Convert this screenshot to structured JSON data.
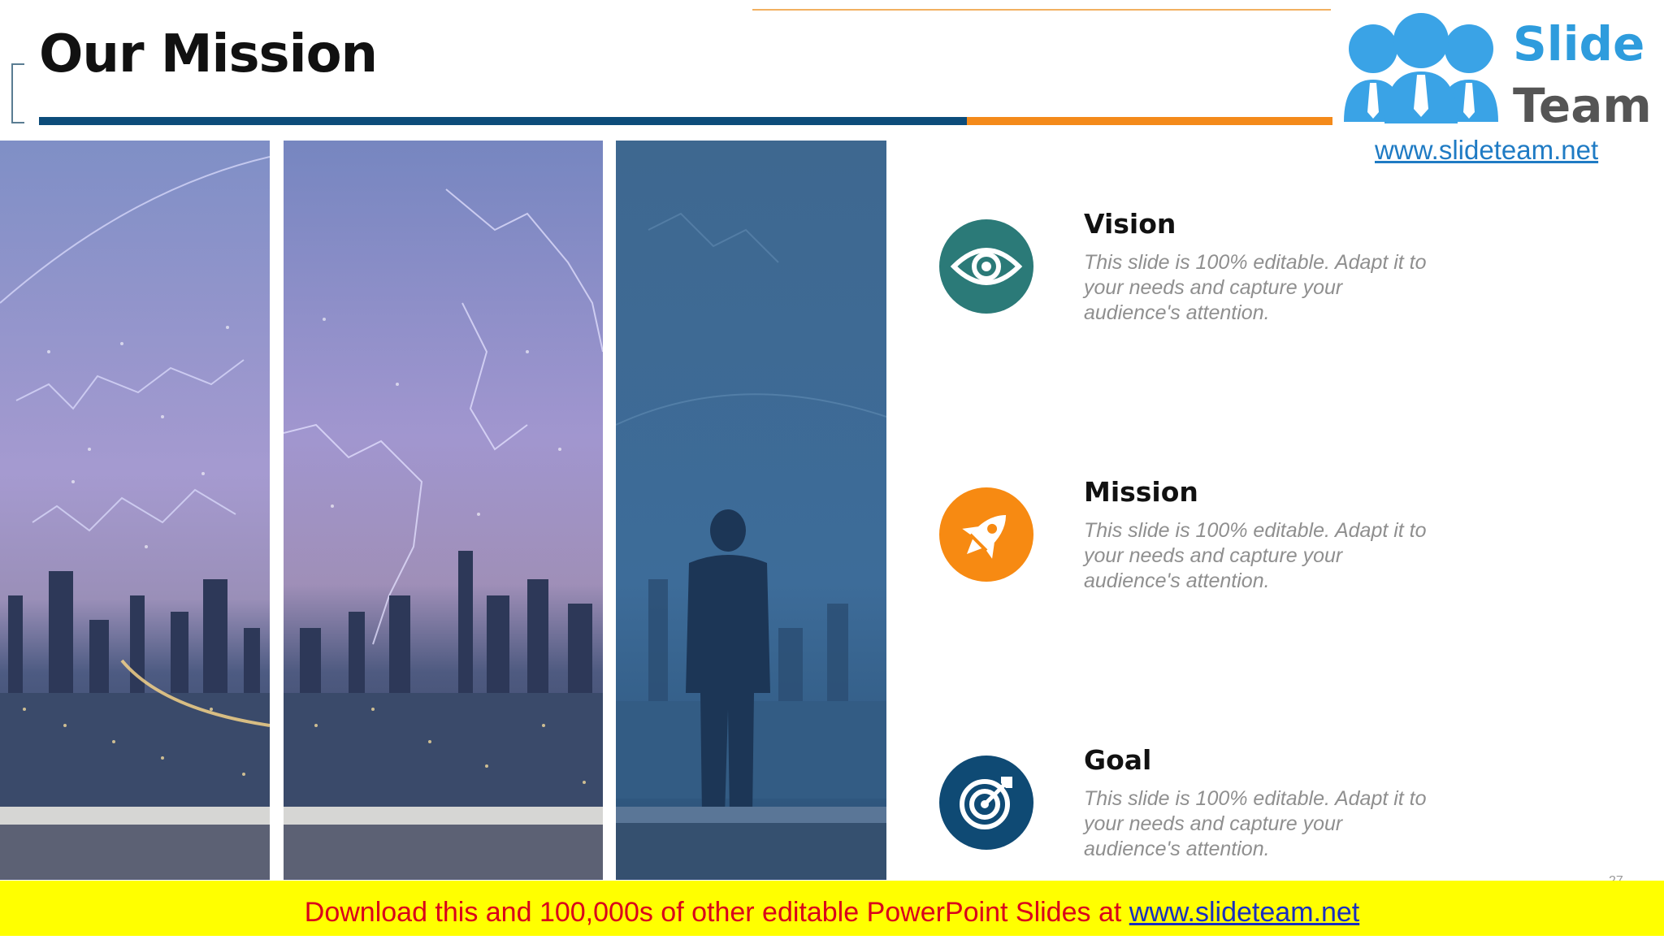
{
  "slide": {
    "title": "Our Mission",
    "page_number": "27"
  },
  "logo": {
    "word1": "Slide",
    "word2": "Team",
    "url": "www.slideteam.net"
  },
  "items": [
    {
      "heading": "Vision",
      "body": "This slide is 100% editable. Adapt it to your needs and capture your audience's attention.",
      "icon": "eye-icon",
      "color": "#2b7a78"
    },
    {
      "heading": "Mission",
      "body": "This slide is 100% editable. Adapt it to your needs and capture your audience's attention.",
      "icon": "rocket-icon",
      "color": "#f78a12"
    },
    {
      "heading": "Goal",
      "body": "This slide is 100% editable. Adapt it to your needs and capture your audience's attention.",
      "icon": "target-icon",
      "color": "#0f4a74"
    }
  ],
  "banner": {
    "text": "Download this and 100,000s of other editable PowerPoint Slides at ",
    "link": "www.slideteam.net"
  },
  "colors": {
    "title_bar_blue": "#0d4c7a",
    "title_bar_orange": "#f48a1a",
    "banner_bg": "#ffff00",
    "banner_text": "#d9001b"
  }
}
